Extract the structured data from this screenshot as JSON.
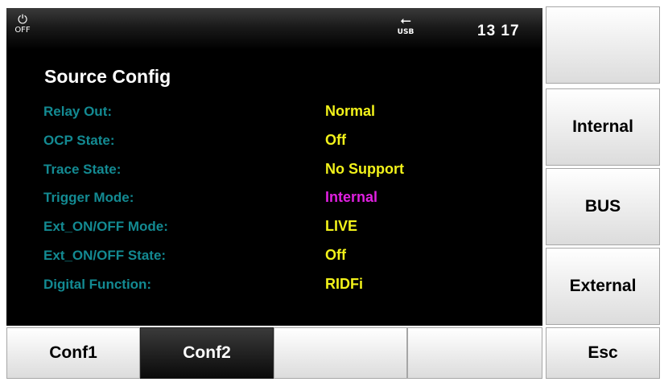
{
  "status_bar": {
    "power_icon": "power-off-icon",
    "power_label": "OFF",
    "usb_icon": "usb-icon",
    "usb_label": "USB",
    "time": "13 17"
  },
  "page_title": "Source Config",
  "settings": [
    {
      "label": "Relay Out:",
      "value": "Normal",
      "color": "#f2f21a"
    },
    {
      "label": "OCP State:",
      "value": "Off",
      "color": "#f2f21a"
    },
    {
      "label": "Trace State:",
      "value": "No Support",
      "color": "#f2f21a"
    },
    {
      "label": "Trigger Mode:",
      "value": "Internal",
      "color": "#e020e0"
    },
    {
      "label": "Ext_ON/OFF Mode:",
      "value": "LIVE",
      "color": "#f2f21a"
    },
    {
      "label": "Ext_ON/OFF State:",
      "value": "Off",
      "color": "#f2f21a"
    },
    {
      "label": "Digital Function:",
      "value": "RIDFi",
      "color": "#f2f21a"
    }
  ],
  "softkeys": [
    "",
    "Internal",
    "BUS",
    "External"
  ],
  "bottom_keys": [
    {
      "label": "Conf1",
      "active": false
    },
    {
      "label": "Conf2",
      "active": true
    },
    {
      "label": "",
      "active": false
    },
    {
      "label": "",
      "active": false
    },
    {
      "label": "Esc",
      "active": false
    }
  ],
  "colors": {
    "label": "#138a92",
    "value": "#f2f21a",
    "highlight": "#e020e0",
    "screen_bg": "#000000"
  }
}
